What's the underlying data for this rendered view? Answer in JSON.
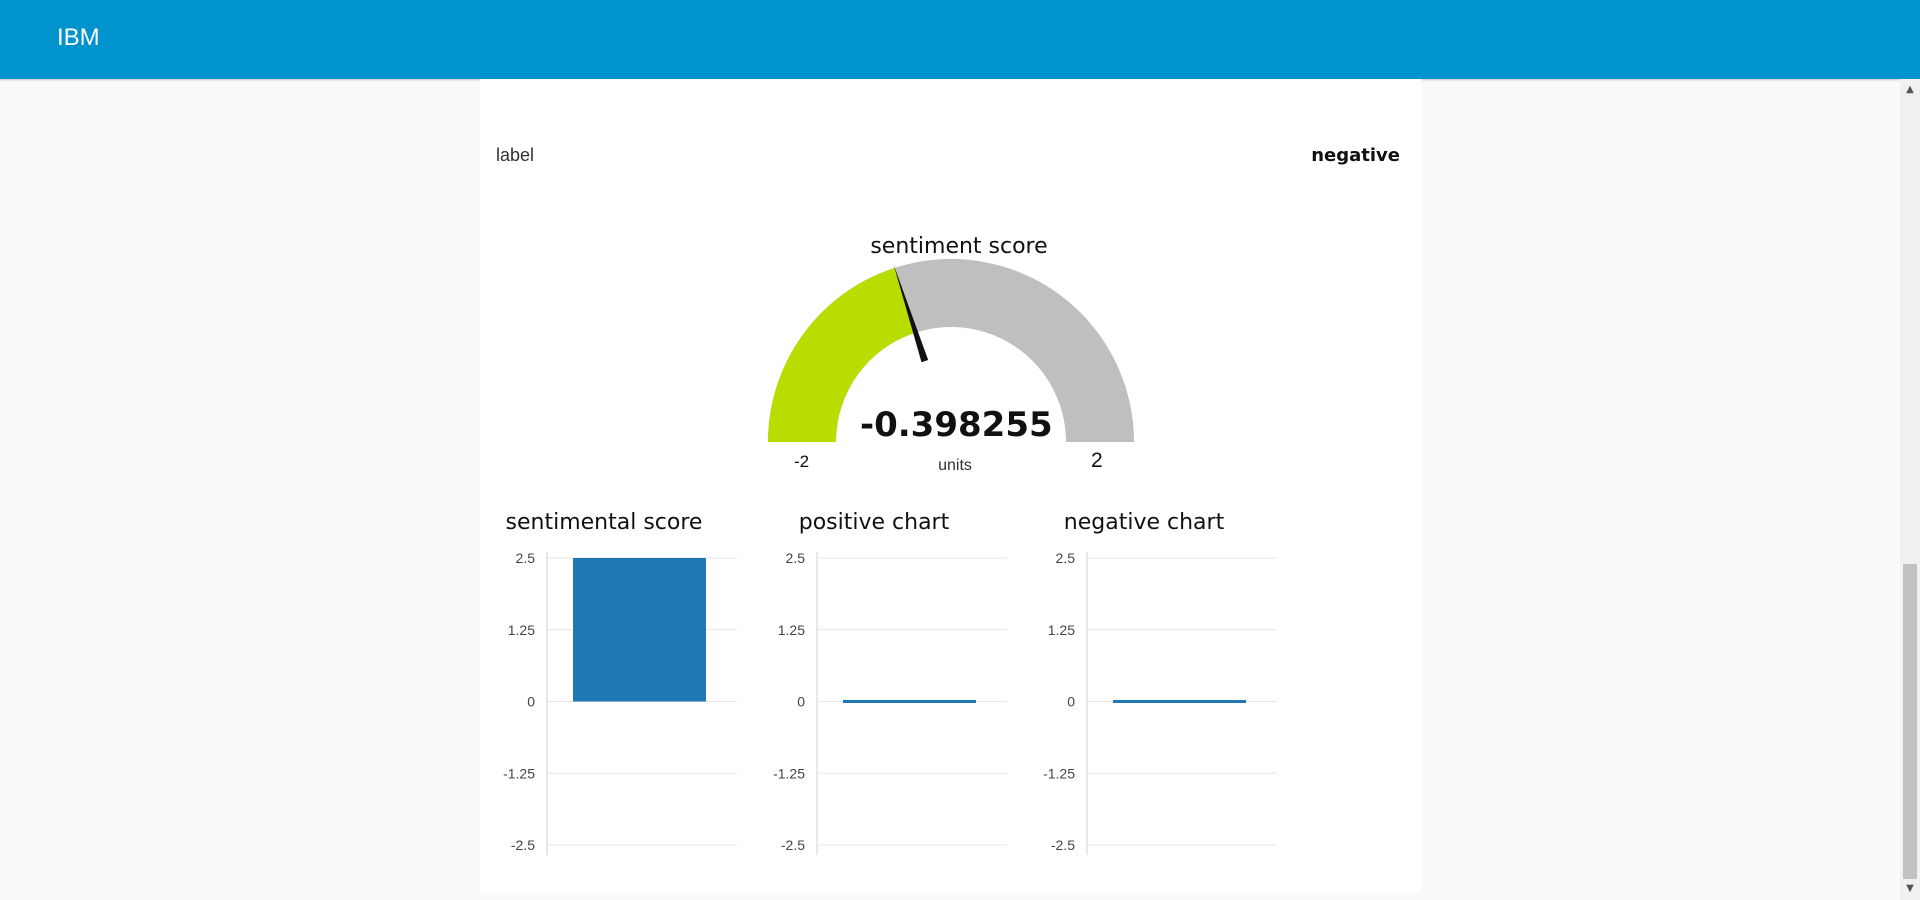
{
  "app": {
    "title": "IBM"
  },
  "label_row": {
    "key": "label",
    "value": "negative"
  },
  "gauge": {
    "title": "sentiment score",
    "value": -0.398255,
    "value_text": "-0.398255",
    "units": "units",
    "min": -2,
    "max": 2,
    "min_label": "-2",
    "max_label": "2",
    "colors": {
      "fill": "#b8dd00",
      "track": "#bfbfbf",
      "needle": "#111111"
    }
  },
  "chart_data": [
    {
      "type": "bar",
      "title": "sentimental score",
      "categories": [
        ""
      ],
      "values": [
        2.5
      ],
      "ylim": [
        -2.5,
        2.5
      ],
      "yticks": [
        "2.5",
        "1.25",
        "0",
        "-1.25",
        "-2.5"
      ],
      "grid": true,
      "color": "#1f77b4"
    },
    {
      "type": "bar",
      "title": "positive chart",
      "categories": [
        ""
      ],
      "values": [
        0
      ],
      "ylim": [
        -2.5,
        2.5
      ],
      "yticks": [
        "2.5",
        "1.25",
        "0",
        "-1.25",
        "-2.5"
      ],
      "grid": true,
      "color": "#1f77b4"
    },
    {
      "type": "bar",
      "title": "negative chart",
      "categories": [
        ""
      ],
      "values": [
        0
      ],
      "ylim": [
        -2.5,
        2.5
      ],
      "yticks": [
        "2.5",
        "1.25",
        "0",
        "-1.25",
        "-2.5"
      ],
      "grid": true,
      "color": "#1f77b4"
    }
  ],
  "icons": {
    "scroll_up": "▲",
    "scroll_down": "▼"
  }
}
